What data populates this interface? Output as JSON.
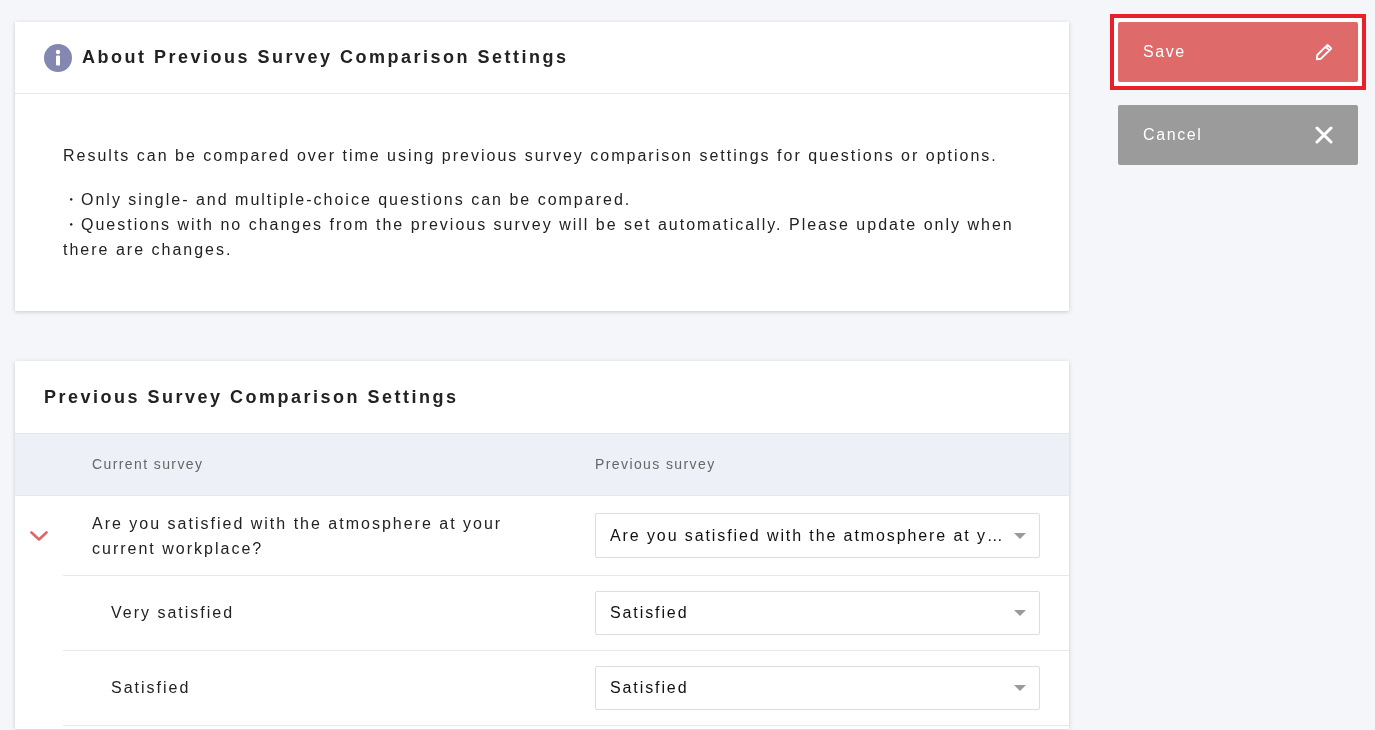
{
  "info_panel": {
    "title": "About Previous Survey Comparison Settings",
    "description": "Results can be compared over time using previous survey comparison settings for questions or options.",
    "notes": [
      "・Only single- and multiple-choice questions can be compared.",
      "・Questions with no changes from the previous survey will be set automatically. Please update only when there are changes."
    ]
  },
  "comparison_panel": {
    "title": "Previous Survey Comparison Settings",
    "columns": [
      "Current survey",
      "Previous survey"
    ],
    "rows": [
      {
        "label": "Are you satisfied with the atmosphere at your current workplace?",
        "selection": "Are you satisfied with the atmosphere at y…",
        "expanded": true,
        "children": [
          {
            "label": "Very satisfied",
            "selection": "Satisfied"
          },
          {
            "label": "Satisfied",
            "selection": "Satisfied"
          }
        ]
      }
    ]
  },
  "actions": [
    {
      "kind": "save",
      "label": "Save",
      "highlighted": true
    },
    {
      "kind": "cancel",
      "label": "Cancel",
      "highlighted": false
    }
  ]
}
